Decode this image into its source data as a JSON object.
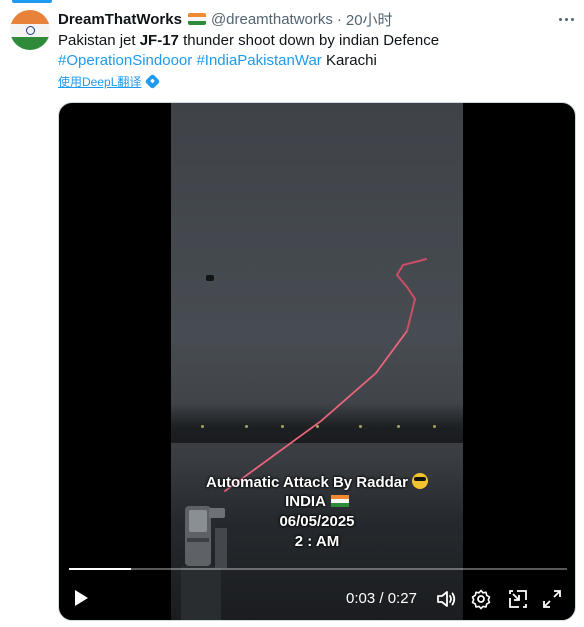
{
  "tweet": {
    "display_name": "DreamThatWorks",
    "handle": "@dreamthatworks",
    "separator": "·",
    "time": "20小时",
    "text_prefix": "Pakistan jet ",
    "text_bold": "JF-17",
    "text_suffix": " thunder shoot down by indian Defence",
    "hashtags": [
      "#OperationSindooor",
      "#IndiaPakistanWar"
    ],
    "text_tail": " Karachi",
    "translate_label": "使用DeepL翻译"
  },
  "video": {
    "overlay": {
      "line1": "Automatic Attack By Raddar",
      "line2": "INDIA",
      "line3": "06/05/2025",
      "line4": "2 : AM"
    },
    "current_time": "0:03",
    "duration": "0:27",
    "time_separator": " / ",
    "progress": 0.125
  },
  "icons": [
    "more-icon",
    "india-flag-icon",
    "deepl-icon",
    "play-icon",
    "volume-icon",
    "settings-icon",
    "pip-icon",
    "fullscreen-icon"
  ],
  "colors": {
    "accent": "#1d9bf0",
    "text": "#0f1419",
    "muted": "#536471",
    "laser": "#e0506a"
  }
}
